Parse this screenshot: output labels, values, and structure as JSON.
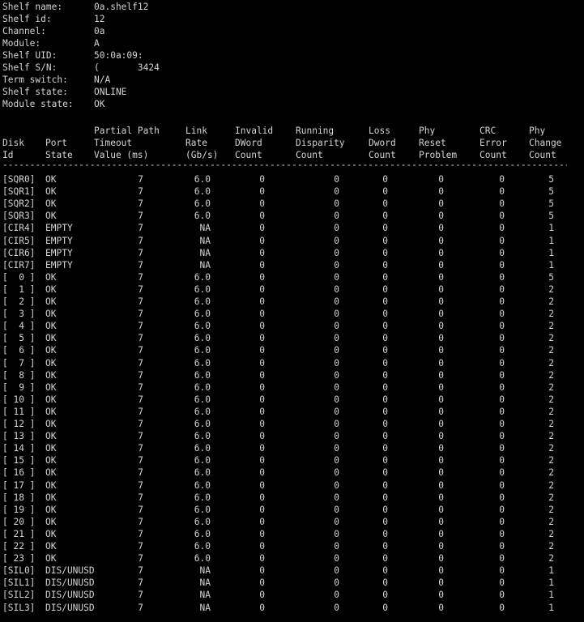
{
  "shelf_info": [
    {
      "label": "Shelf name:",
      "value": "0a.shelf12"
    },
    {
      "label": "Shelf id:",
      "value": "12"
    },
    {
      "label": "Channel:",
      "value": "0a"
    },
    {
      "label": "Module:",
      "value": "A"
    },
    {
      "label": "Shelf UID:",
      "value": "50:0a:09:"
    },
    {
      "label": "Shelf S/N:",
      "value": "(       3424"
    },
    {
      "label": "Term switch:",
      "value": "N/A"
    },
    {
      "label": "Shelf state:",
      "value": "ONLINE"
    },
    {
      "label": "Module state:",
      "value": "OK"
    }
  ],
  "header_lines": [
    [
      "",
      "",
      "Partial Path",
      "Link",
      "Invalid",
      "Running",
      "Loss",
      "Phy",
      "CRC",
      "Phy"
    ],
    [
      "Disk",
      "Port",
      "Timeout",
      "Rate",
      "DWord",
      "Disparity",
      "Dword",
      "Reset",
      "Error",
      "Change"
    ],
    [
      "Id",
      "State",
      "Value (ms)",
      "(Gb/s)",
      "Count",
      "Count",
      "Count",
      "Problem",
      "Count",
      "Count"
    ]
  ],
  "divider": "--------------------------------------------------------------------------------------------------------------------------------",
  "rows": [
    [
      "[SQR0]",
      "OK",
      "7",
      "6.0",
      "0",
      "0",
      "0",
      "0",
      "0",
      "5"
    ],
    [
      "[SQR1]",
      "OK",
      "7",
      "6.0",
      "0",
      "0",
      "0",
      "0",
      "0",
      "5"
    ],
    [
      "[SQR2]",
      "OK",
      "7",
      "6.0",
      "0",
      "0",
      "0",
      "0",
      "0",
      "5"
    ],
    [
      "[SQR3]",
      "OK",
      "7",
      "6.0",
      "0",
      "0",
      "0",
      "0",
      "0",
      "5"
    ],
    [
      "[CIR4]",
      "EMPTY",
      "7",
      "NA",
      "0",
      "0",
      "0",
      "0",
      "0",
      "1"
    ],
    [
      "[CIR5]",
      "EMPTY",
      "7",
      "NA",
      "0",
      "0",
      "0",
      "0",
      "0",
      "1"
    ],
    [
      "[CIR6]",
      "EMPTY",
      "7",
      "NA",
      "0",
      "0",
      "0",
      "0",
      "0",
      "1"
    ],
    [
      "[CIR7]",
      "EMPTY",
      "7",
      "NA",
      "0",
      "0",
      "0",
      "0",
      "0",
      "1"
    ],
    [
      "[  0 ]",
      "OK",
      "7",
      "6.0",
      "0",
      "0",
      "0",
      "0",
      "0",
      "5"
    ],
    [
      "[  1 ]",
      "OK",
      "7",
      "6.0",
      "0",
      "0",
      "0",
      "0",
      "0",
      "2"
    ],
    [
      "[  2 ]",
      "OK",
      "7",
      "6.0",
      "0",
      "0",
      "0",
      "0",
      "0",
      "2"
    ],
    [
      "[  3 ]",
      "OK",
      "7",
      "6.0",
      "0",
      "0",
      "0",
      "0",
      "0",
      "2"
    ],
    [
      "[  4 ]",
      "OK",
      "7",
      "6.0",
      "0",
      "0",
      "0",
      "0",
      "0",
      "2"
    ],
    [
      "[  5 ]",
      "OK",
      "7",
      "6.0",
      "0",
      "0",
      "0",
      "0",
      "0",
      "2"
    ],
    [
      "[  6 ]",
      "OK",
      "7",
      "6.0",
      "0",
      "0",
      "0",
      "0",
      "0",
      "2"
    ],
    [
      "[  7 ]",
      "OK",
      "7",
      "6.0",
      "0",
      "0",
      "0",
      "0",
      "0",
      "2"
    ],
    [
      "[  8 ]",
      "OK",
      "7",
      "6.0",
      "0",
      "0",
      "0",
      "0",
      "0",
      "2"
    ],
    [
      "[  9 ]",
      "OK",
      "7",
      "6.0",
      "0",
      "0",
      "0",
      "0",
      "0",
      "2"
    ],
    [
      "[ 10 ]",
      "OK",
      "7",
      "6.0",
      "0",
      "0",
      "0",
      "0",
      "0",
      "2"
    ],
    [
      "[ 11 ]",
      "OK",
      "7",
      "6.0",
      "0",
      "0",
      "0",
      "0",
      "0",
      "2"
    ],
    [
      "[ 12 ]",
      "OK",
      "7",
      "6.0",
      "0",
      "0",
      "0",
      "0",
      "0",
      "2"
    ],
    [
      "[ 13 ]",
      "OK",
      "7",
      "6.0",
      "0",
      "0",
      "0",
      "0",
      "0",
      "2"
    ],
    [
      "[ 14 ]",
      "OK",
      "7",
      "6.0",
      "0",
      "0",
      "0",
      "0",
      "0",
      "2"
    ],
    [
      "[ 15 ]",
      "OK",
      "7",
      "6.0",
      "0",
      "0",
      "0",
      "0",
      "0",
      "2"
    ],
    [
      "[ 16 ]",
      "OK",
      "7",
      "6.0",
      "0",
      "0",
      "0",
      "0",
      "0",
      "2"
    ],
    [
      "[ 17 ]",
      "OK",
      "7",
      "6.0",
      "0",
      "0",
      "0",
      "0",
      "0",
      "2"
    ],
    [
      "[ 18 ]",
      "OK",
      "7",
      "6.0",
      "0",
      "0",
      "0",
      "0",
      "0",
      "2"
    ],
    [
      "[ 19 ]",
      "OK",
      "7",
      "6.0",
      "0",
      "0",
      "0",
      "0",
      "0",
      "2"
    ],
    [
      "[ 20 ]",
      "OK",
      "7",
      "6.0",
      "0",
      "0",
      "0",
      "0",
      "0",
      "2"
    ],
    [
      "[ 21 ]",
      "OK",
      "7",
      "6.0",
      "0",
      "0",
      "0",
      "0",
      "0",
      "2"
    ],
    [
      "[ 22 ]",
      "OK",
      "7",
      "6.0",
      "0",
      "0",
      "0",
      "0",
      "0",
      "2"
    ],
    [
      "[ 23 ]",
      "OK",
      "7",
      "6.0",
      "0",
      "0",
      "0",
      "0",
      "0",
      "2"
    ],
    [
      "[SIL0]",
      "DIS/UNUSD",
      "7",
      "NA",
      "0",
      "0",
      "0",
      "0",
      "0",
      "1"
    ],
    [
      "[SIL1]",
      "DIS/UNUSD",
      "7",
      "NA",
      "0",
      "0",
      "0",
      "0",
      "0",
      "1"
    ],
    [
      "[SIL2]",
      "DIS/UNUSD",
      "7",
      "NA",
      "0",
      "0",
      "0",
      "0",
      "0",
      "1"
    ],
    [
      "[SIL3]",
      "DIS/UNUSD",
      "7",
      "NA",
      "0",
      "0",
      "0",
      "0",
      "0",
      "1"
    ]
  ]
}
